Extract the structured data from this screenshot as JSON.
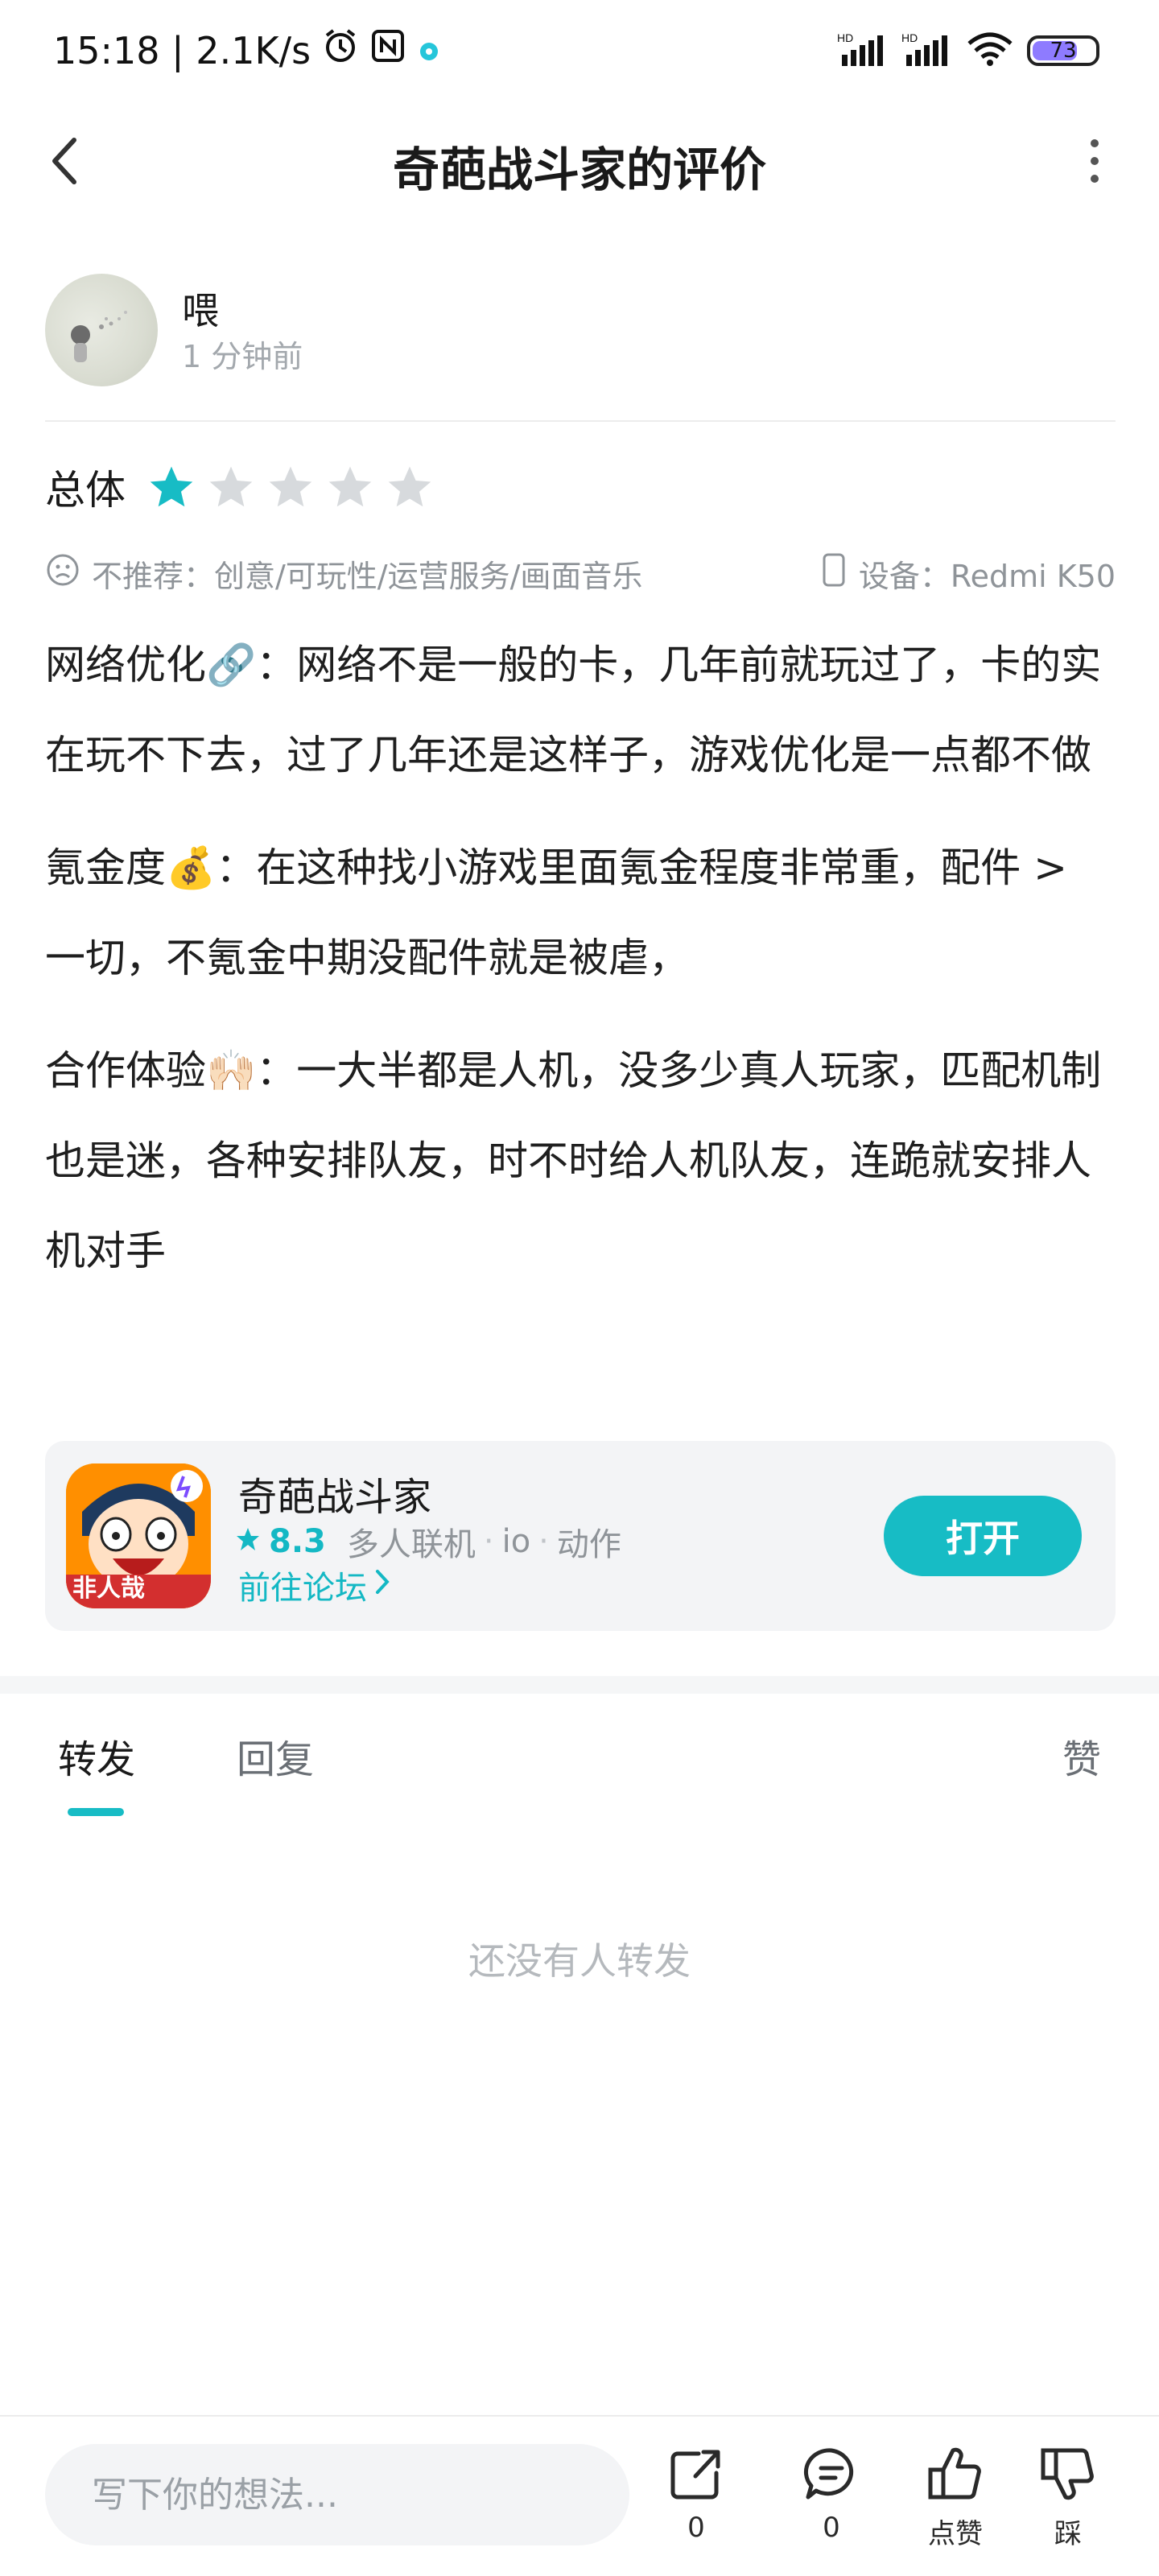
{
  "status_bar": {
    "time_speed": "15:18 | 2.1K/s",
    "battery": "73",
    "colors": {
      "battery_fill": "#8e7bff"
    }
  },
  "nav": {
    "title": "奇葩战斗家的评价"
  },
  "author": {
    "name": "喂",
    "time": "1 分钟前"
  },
  "rating": {
    "label": "总体",
    "score": 1,
    "max": 5
  },
  "meta": {
    "not_recommend": "不推荐：创意/可玩性/运营服务/画面音乐",
    "device": "设备：Redmi K50"
  },
  "review": {
    "paragraphs": [
      "网络优化🔗：网络不是一般的卡，几年前就玩过了，卡的实在玩不下去，过了几年还是这样子，游戏优化是一点都不做",
      "氪金度💰：在这种找小游戏里面氪金程度非常重，配件 > 一切，不氪金中期没配件就是被虐，",
      "合作体验🙌🏻：一大半都是人机，没多少真人玩家，匹配机制也是迷，各种安排队友，时不时给人机队友，连跪就安排人机对手"
    ]
  },
  "game_card": {
    "name": "奇葩战斗家",
    "score": "8.3",
    "tags": [
      "多人联机",
      "io",
      "动作"
    ],
    "forum_link": "前往论坛",
    "open_button": "打开",
    "icon_text": "非人哉",
    "colors": {
      "accent": "#17bcc5"
    }
  },
  "tabs": {
    "repost": "转发",
    "reply": "回复",
    "like": "赞"
  },
  "empty_state": "还没有人转发",
  "bottom_bar": {
    "input_placeholder": "写下你的想法...",
    "share_count": "0",
    "comment_count": "0",
    "like_label": "点赞",
    "dislike_label": "踩"
  }
}
